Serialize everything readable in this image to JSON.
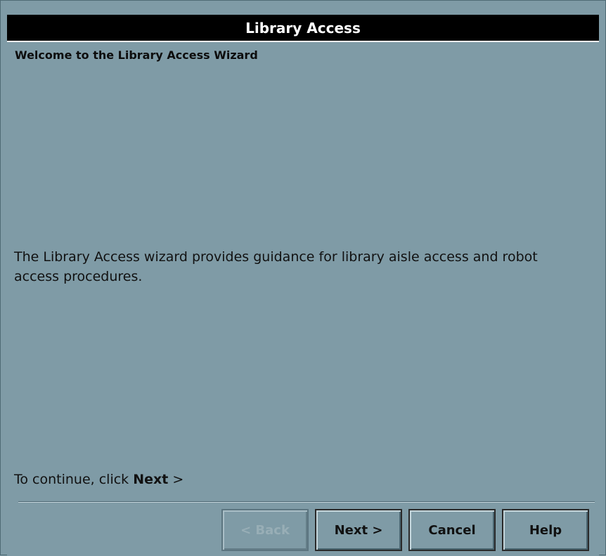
{
  "window": {
    "title": "Library Access"
  },
  "wizard": {
    "heading": "Welcome to the Library Access Wizard",
    "description": "The Library Access wizard provides guidance for library aisle access and robot access procedures.",
    "continue_prefix": "To continue, click ",
    "continue_action": "Next",
    "continue_suffix": " >"
  },
  "buttons": {
    "back_label": "< Back",
    "back_enabled": false,
    "next_label": "Next >",
    "cancel_label": "Cancel",
    "help_label": "Help"
  },
  "colors": {
    "background": "#7f9ba6",
    "titlebar": "#000000",
    "title_text": "#ffffff"
  }
}
